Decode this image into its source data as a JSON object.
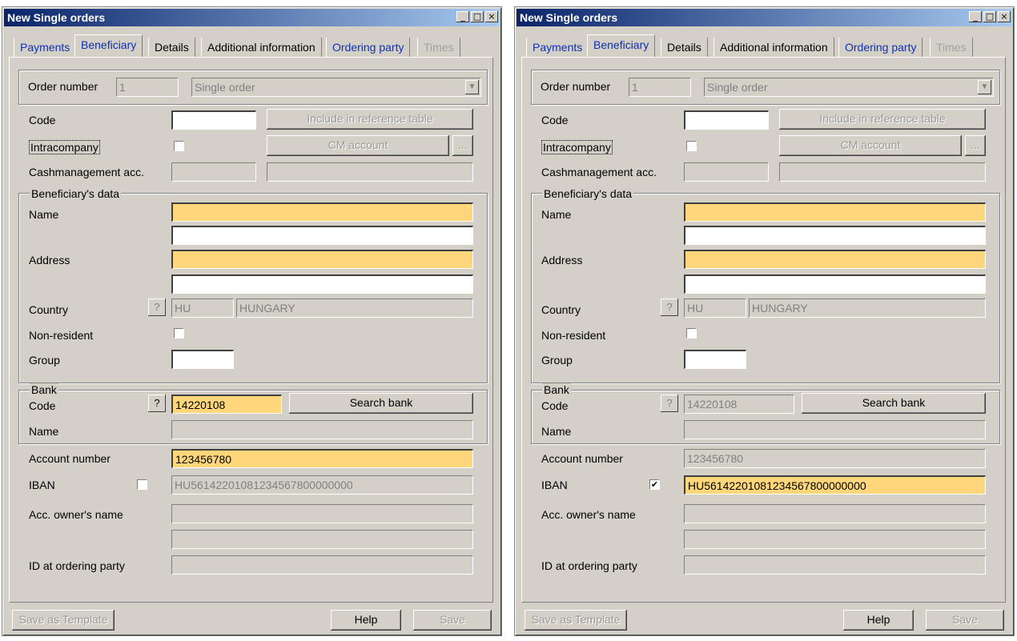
{
  "windows": [
    {
      "title": "New Single orders",
      "tabs": [
        "Payments",
        "Beneficiary",
        "Details",
        "Additional information",
        "Ordering party",
        "Times"
      ],
      "order_number_label": "Order number",
      "order_number_value": "1",
      "order_type": "Single order",
      "code_label": "Code",
      "include_button": "Include in reference table",
      "intracompany_label": "Intracompany",
      "cm_account_button": "CM account",
      "ellipsis": "...",
      "cashmanagement_label": "Cashmanagement acc.",
      "beneficiary_group": "Beneficiary's data",
      "name_label": "Name",
      "address_label": "Address",
      "country_label": "Country",
      "country_code": "HU",
      "country_name": "HUNGARY",
      "nonresident_label": "Non-resident",
      "group_label": "Group",
      "bank_group": "Bank",
      "bank_code_label": "Code",
      "bank_code_value": "14220108",
      "search_bank_button": "Search bank",
      "bank_name_label": "Name",
      "account_number_label": "Account number",
      "account_number_value": "123456780",
      "iban_label": "IBAN",
      "iban_value": "HU56142201081234567800000000",
      "iban_checked": false,
      "acc_owner_label": "Acc. owner's name",
      "id_ordering_label": "ID at ordering party",
      "save_template_button": "Save as Template",
      "help_button": "Help",
      "save_button": "Save",
      "q_mark": "?"
    },
    {
      "title": "New Single orders",
      "tabs": [
        "Payments",
        "Beneficiary",
        "Details",
        "Additional information",
        "Ordering party",
        "Times"
      ],
      "order_number_label": "Order number",
      "order_number_value": "1",
      "order_type": "Single order",
      "code_label": "Code",
      "include_button": "Include in reference table",
      "intracompany_label": "Intracompany",
      "cm_account_button": "CM account",
      "ellipsis": "...",
      "cashmanagement_label": "Cashmanagement acc.",
      "beneficiary_group": "Beneficiary's data",
      "name_label": "Name",
      "address_label": "Address",
      "country_label": "Country",
      "country_code": "HU",
      "country_name": "HUNGARY",
      "nonresident_label": "Non-resident",
      "group_label": "Group",
      "bank_group": "Bank",
      "bank_code_label": "Code",
      "bank_code_value": "14220108",
      "search_bank_button": "Search bank",
      "bank_name_label": "Name",
      "account_number_label": "Account number",
      "account_number_value": "123456780",
      "iban_label": "IBAN",
      "iban_value": "HU56142201081234567800000000",
      "iban_checked": true,
      "acc_owner_label": "Acc. owner's name",
      "id_ordering_label": "ID at ordering party",
      "save_template_button": "Save as Template",
      "help_button": "Help",
      "save_button": "Save",
      "q_mark": "?"
    }
  ],
  "title_buttons": {
    "minimize": "_",
    "maximize": "□",
    "close": "×"
  },
  "check_mark": "✔"
}
